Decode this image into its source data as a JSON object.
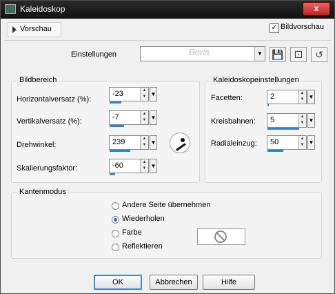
{
  "window": {
    "title": "Kaleidoskop",
    "close_label": "x"
  },
  "toolbar": {
    "preview_label": "Vorschau",
    "bildvorschau_label": "Bildvorschau",
    "bildvorschau_checked": true,
    "bildvorschau_mark": "✓"
  },
  "settings": {
    "label": "Einstellungen",
    "preset_value": "",
    "watermark_text": "Boris",
    "dropdown_glyph": "▼"
  },
  "icons": {
    "save": "save-icon",
    "random": "dice-icon",
    "reset": "reset-icon"
  },
  "bildbereich": {
    "title": "Bildbereich",
    "fields": [
      {
        "label": "Horizontalversatz (%):",
        "value": "-23",
        "fill": 0.38
      },
      {
        "label": "Vertikalversatz (%):",
        "value": "-7",
        "fill": 0.46
      },
      {
        "label": "Drehwinkel:",
        "value": "239",
        "fill": 0.66
      },
      {
        "label": "Skalierungsfaktor:",
        "value": "-60",
        "fill": 0.18
      }
    ]
  },
  "kaleido": {
    "title": "Kaleidoskopeinstellungen",
    "fields": [
      {
        "label": "Facetten:",
        "value": "2",
        "fill": 0.05
      },
      {
        "label": "Kreisbahnen:",
        "value": "5",
        "fill": 1.0
      },
      {
        "label": "Radialeinzug:",
        "value": "50",
        "fill": 0.5
      }
    ]
  },
  "kantenmodus": {
    "title": "Kantenmodus",
    "options": [
      {
        "label": "Andere Seite übernehmen",
        "selected": false
      },
      {
        "label": "Wiederholen",
        "selected": true
      },
      {
        "label": "Farbe",
        "selected": false
      },
      {
        "label": "Reflektieren",
        "selected": false
      }
    ]
  },
  "buttons": {
    "ok": "OK",
    "cancel": "Abbrechen",
    "help": "Hilfe"
  },
  "colors": {
    "accent": "#2a86d8",
    "titlebar": "#1a1a1a",
    "close": "#c93b3b"
  }
}
